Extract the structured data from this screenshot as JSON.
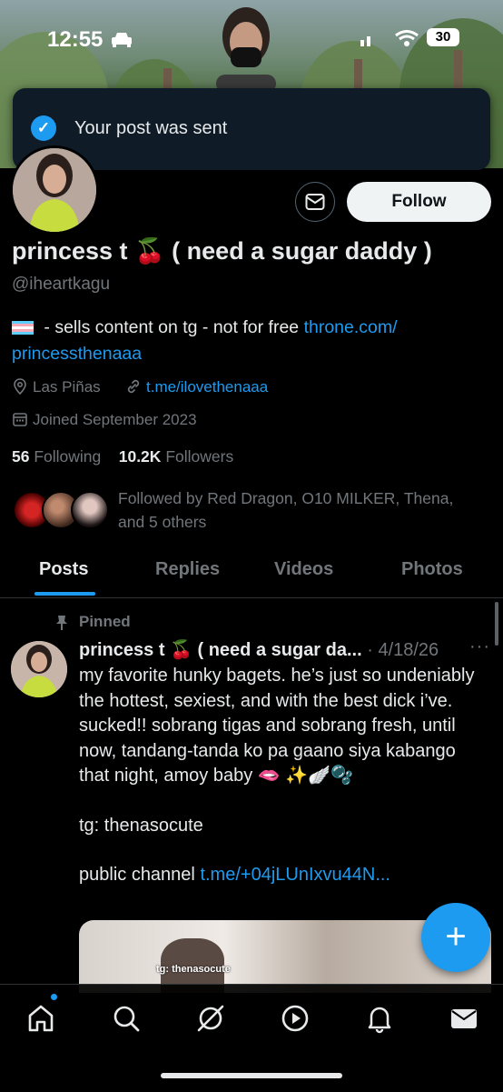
{
  "status_bar": {
    "time": "12:55",
    "battery": "30"
  },
  "toast": {
    "message": "Your post was sent"
  },
  "profile": {
    "name": "princess t 🍒 ( need a sugar daddy )",
    "handle": "@iheartkagu",
    "bio_text": " - sells content on tg - not for free ",
    "bio_link_1": "throne.com/",
    "bio_link_2": "princessthenaaa",
    "location": "Las Piñas",
    "website": "t.me/ilovethenaaa",
    "joined": "Joined September 2023",
    "following_count": "56",
    "following_label": "Following",
    "followers_count": "10.2K",
    "followers_label": "Followers",
    "followed_by": "Followed by Red Dragon, O10 MILKER, Thena, and 5 others",
    "follow_button": "Follow"
  },
  "tabs": [
    {
      "label": "Posts",
      "active": true
    },
    {
      "label": "Replies",
      "active": false
    },
    {
      "label": "Videos",
      "active": false
    },
    {
      "label": "Photos",
      "active": false
    }
  ],
  "post": {
    "pinned_label": "Pinned",
    "author": "princess t 🍒 ( need a sugar da...",
    "date": "· 4/18/26",
    "more": "···",
    "body_1": "my favorite hunky bagets. he’s just so undeniably the hottest, sexiest, and with the best dick i’ve. sucked!! sobrang tigas and sobrang fresh, until now, tandang-tanda ko pa gaano siya kabango that night, amoy baby 🫦 ✨🪽🫧",
    "body_2": "tg: thenasocute",
    "body_3_prefix": "public channel ",
    "body_3_link": "t.me/+04jLUnIxvu44N...",
    "media_caption": "tg: thenasocute"
  },
  "fab": {
    "label": "+"
  },
  "bottom_nav": [
    "home-icon",
    "search-icon",
    "grok-icon",
    "video-icon",
    "notifications-icon",
    "messages-icon"
  ],
  "colors": {
    "accent": "#1d9bf0",
    "background": "#000000",
    "muted": "#71767b",
    "text": "#e7e9ea"
  }
}
